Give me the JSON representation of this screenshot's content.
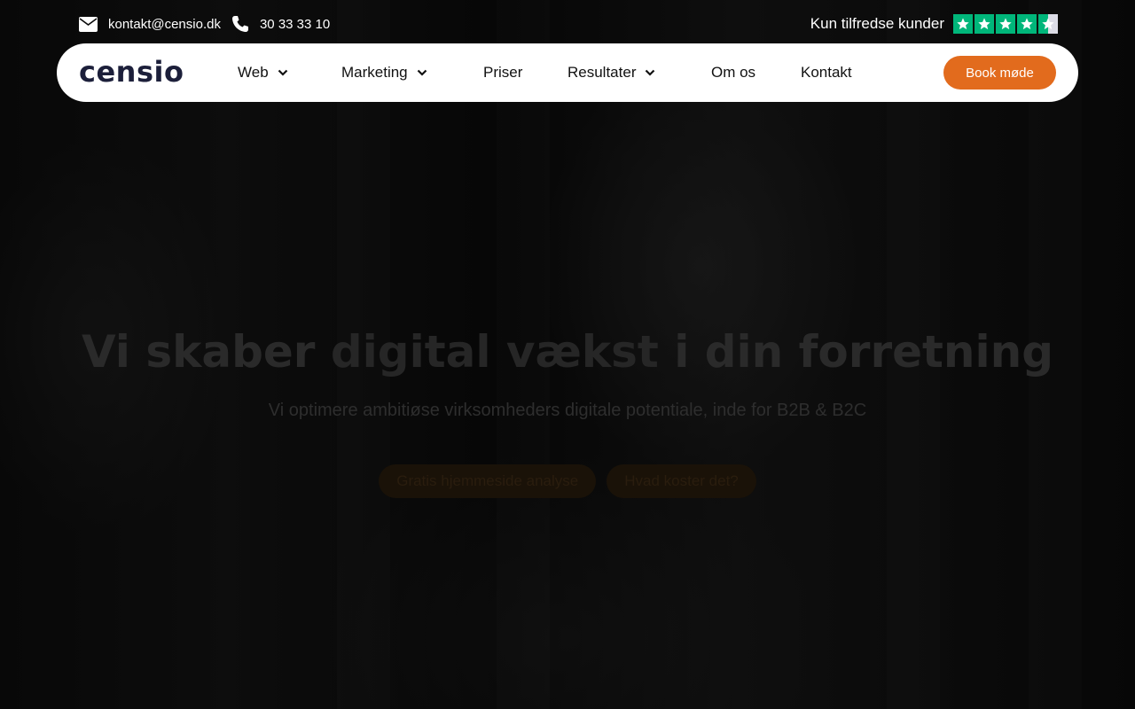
{
  "topbar": {
    "email": "kontakt@censio.dk",
    "phone": "30 33 33 10",
    "trust_label": "Kun tilfredse kunder",
    "rating_stars": 4.5
  },
  "nav": {
    "logo": "censio",
    "items": [
      {
        "label": "Web",
        "has_dropdown": true
      },
      {
        "label": "Marketing",
        "has_dropdown": true
      },
      {
        "label": "Priser",
        "has_dropdown": false
      },
      {
        "label": "Resultater",
        "has_dropdown": true
      },
      {
        "label": "Om os",
        "has_dropdown": false
      },
      {
        "label": "Kontakt",
        "has_dropdown": false
      }
    ],
    "cta_label": "Book møde"
  },
  "hero": {
    "headline_pre": "Vi skaber ",
    "headline_bold": "digital vækst",
    "headline_post": " i din forretning",
    "subtitle": "Vi optimere ambitiøse virksomheders digitale potentiale, inde for B2B & B2C",
    "buttons": [
      "Gratis hjemmeside analyse",
      "Hvad koster det?"
    ]
  },
  "colors": {
    "accent": "#e26b1d",
    "trustpilot_green": "#00b67a",
    "logo_navy": "#1c1f3a"
  }
}
